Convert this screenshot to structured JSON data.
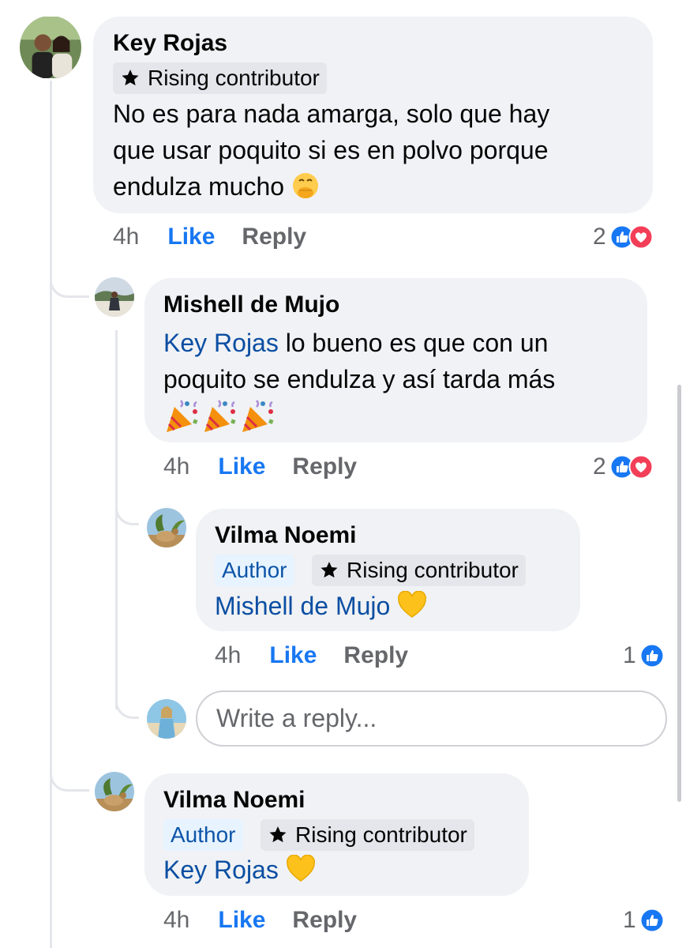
{
  "comments": [
    {
      "name": "Key Rojas",
      "badges": [
        "Rising contributor"
      ],
      "lines": [
        "No es para nada amarga, solo que hay",
        "que usar poquito si es en polvo porque",
        "endulza mucho"
      ],
      "emoji": "hand-over-mouth-emoji",
      "time": "4h",
      "like": "Like",
      "reply": "Reply",
      "reactions": "2"
    },
    {
      "name": "Mishell de Mujo",
      "mention": "Key Rojas",
      "lines": [
        " lo bueno es que con un",
        "poquito se endulza y así tarda más"
      ],
      "emoji": "party-popper-emoji",
      "time": "4h",
      "like": "Like",
      "reply": "Reply",
      "reactions": "2"
    },
    {
      "name": "Vilma Noemi",
      "badges": [
        "Author",
        "Rising contributor"
      ],
      "mention": "Mishell de Mujo",
      "emoji": "yellow-heart-emoji",
      "time": "4h",
      "like": "Like",
      "reply": "Reply",
      "reactions": "1"
    },
    {
      "name": "Vilma Noemi",
      "badges": [
        "Author",
        "Rising contributor"
      ],
      "mention": "Key Rojas",
      "emoji": "yellow-heart-emoji",
      "time": "4h",
      "like": "Like",
      "reply": "Reply",
      "reactions": "1"
    }
  ],
  "reply_box": {
    "placeholder": "Write a reply..."
  },
  "colors": {
    "like_blue": "#1877f2",
    "love_red": "#f33e58",
    "mention_blue": "#0b4ea2",
    "bubble_gray": "#f0f2f5",
    "heart_yellow": "#fcc21b"
  },
  "icons": {
    "like_reaction": "thumbs-up-icon",
    "love_reaction": "heart-icon",
    "badge": "star-icon"
  }
}
